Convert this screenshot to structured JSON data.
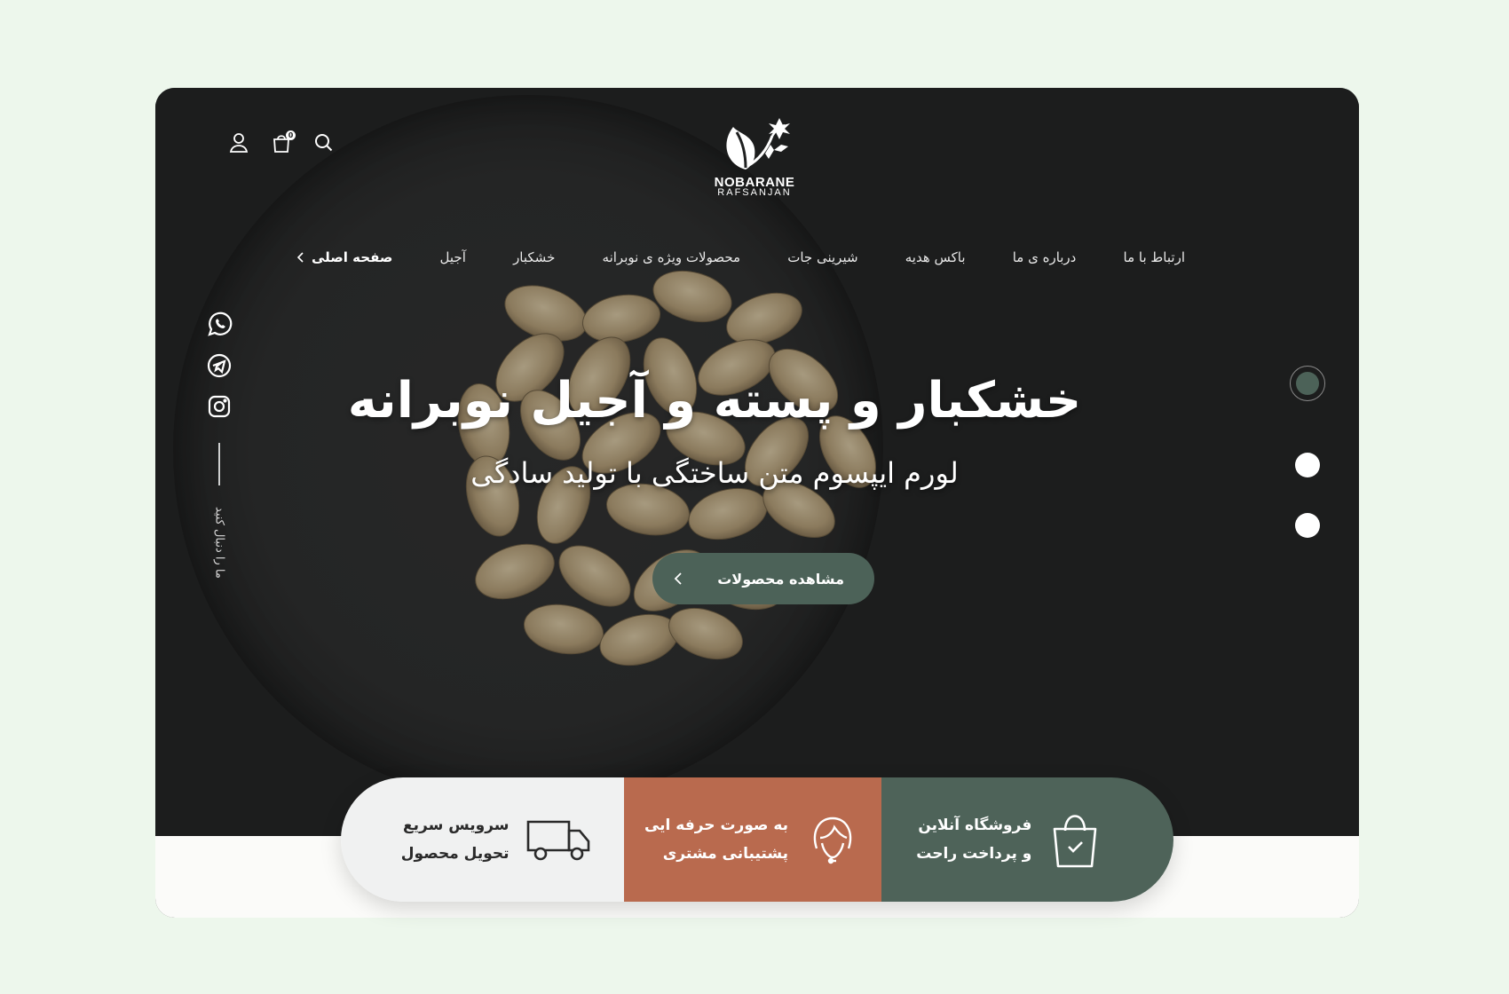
{
  "brand": {
    "name": "NOBARANE",
    "sub": "RAFSANJAN"
  },
  "header": {
    "icons": [
      "search-icon",
      "cart-icon",
      "user-icon"
    ],
    "cart_count": "0"
  },
  "nav": {
    "items": [
      {
        "label": "صفحه اصلی",
        "active": true
      },
      {
        "label": "آجیل"
      },
      {
        "label": "خشکبار"
      },
      {
        "label": "محصولات ویژه ی نوبرانه"
      },
      {
        "label": "شیرینی جات"
      },
      {
        "label": "باکس هدیه"
      },
      {
        "label": "درباره ی ما"
      },
      {
        "label": "ارتباط با ما"
      }
    ]
  },
  "social": {
    "icons": [
      "whatsapp-icon",
      "telegram-icon",
      "instagram-icon"
    ],
    "follow_label": "ما را دنبال کنید"
  },
  "hero": {
    "title": "خشکبار و پسته و آجیل نوبرانه",
    "subtitle": "لورم ایپسوم متن ساختگی با تولید سادگی",
    "cta_label": "مشاهده محصولات"
  },
  "slider": {
    "count": 3,
    "active_index": 0
  },
  "features": [
    {
      "line1": "فروشگاه آنلاین",
      "line2": "و پرداخت راحت",
      "icon": "shopping-bag-icon"
    },
    {
      "line1": "به صورت حرفه ایی",
      "line2": "پشتیبانی مشتری",
      "icon": "support-agent-icon"
    },
    {
      "line1": "سرویس سریع",
      "line2": "تحویل محصول",
      "icon": "delivery-truck-icon"
    }
  ],
  "colors": {
    "page_bg": "#edf7ec",
    "hero_bg": "#1f2020",
    "primary_green": "#4c6258",
    "accent_terracotta": "#b96a4e",
    "light_card": "#f0f1f1"
  }
}
